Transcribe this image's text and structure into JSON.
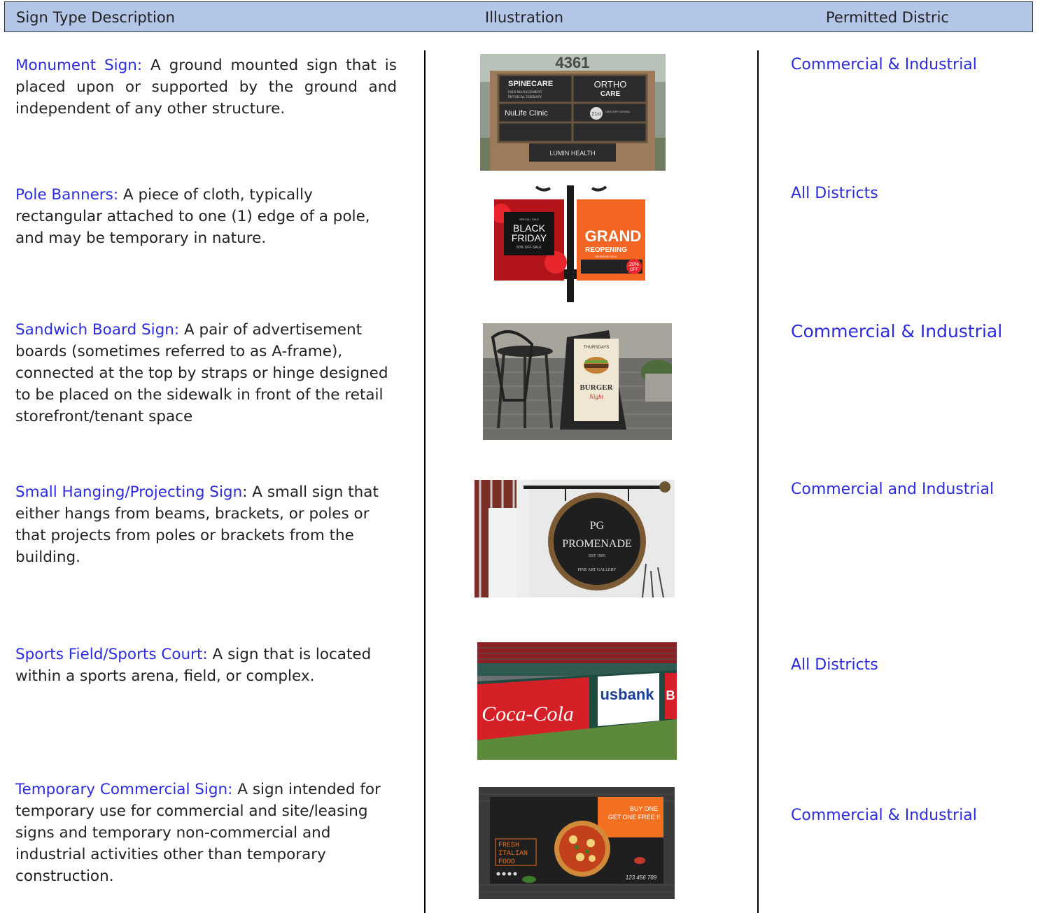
{
  "header": {
    "col1": "Sign Type Description",
    "col2": "Illustration",
    "col3": "Permitted Distric"
  },
  "rows": [
    {
      "term": "Monument Sign:",
      "description": " A ground mounted sign that is placed upon or supported by the ground and independent of any other structure.",
      "district": "Commercial & Industrial",
      "image_text": [
        "4361",
        "SPINECARE",
        "PAIN MANAGEMENT",
        "PHYSICAL THERAPY",
        "ORTHO",
        "CARE",
        "NuLife Clinic",
        "21st",
        "CENTURY DENTAL",
        "LUMIN HEALTH"
      ]
    },
    {
      "term": "Pole Banners:",
      "description": " A piece of cloth, typically rectangular attached to one (1) edge of a pole, and may be temporary in nature.",
      "district": "All Districts",
      "image_text": [
        "SPECIAL SALE",
        "BLACK",
        "FRIDAY",
        "50% OFF SALE",
        "GRAND",
        "REOPENING",
        "WEEKEND SALE",
        "20%",
        "OFF"
      ]
    },
    {
      "term": "Sandwich Board Sign:",
      "description": " A pair of advertisement boards (sometimes referred to as A-frame), connected at the top by straps or hinge designed to be placed on the sidewalk in front of the retail storefront/tenant space",
      "district": "Commercial & Industrial",
      "image_text": [
        "THURSDAYS",
        "BURGER",
        "Night"
      ]
    },
    {
      "term": "Small Hanging/Projecting Sign",
      "description": ": A small sign that either hangs from beams, brackets, or poles or that projects from poles or brackets from the building.",
      "district": "Commercial and Industrial",
      "image_text": [
        "PG",
        "PROMENADE",
        "EST 1995",
        "FINE ART GALLERY"
      ]
    },
    {
      "term": "Sports Field/Sports Court:",
      "description": " A sign that is located within a sports arena, field, or complex.",
      "district": "All Districts",
      "image_text": [
        "Coca-Cola",
        "usbank",
        "B"
      ]
    },
    {
      "term": "Temporary Commercial Sign:",
      "description": " A sign intended for temporary use for commercial and site/leasing signs and temporary non-commercial and industrial activities other than temporary construction.",
      "district": "Commercial & Industrial",
      "image_text": [
        "BUY ONE",
        "GET ONE FREE !!",
        "FRESH",
        "ITALIAN",
        "FOOD",
        "123 456 789"
      ]
    }
  ],
  "colors": {
    "header_bg": "#b4c6e7",
    "term_blue": "#2b2be0",
    "body_text": "#222222"
  }
}
